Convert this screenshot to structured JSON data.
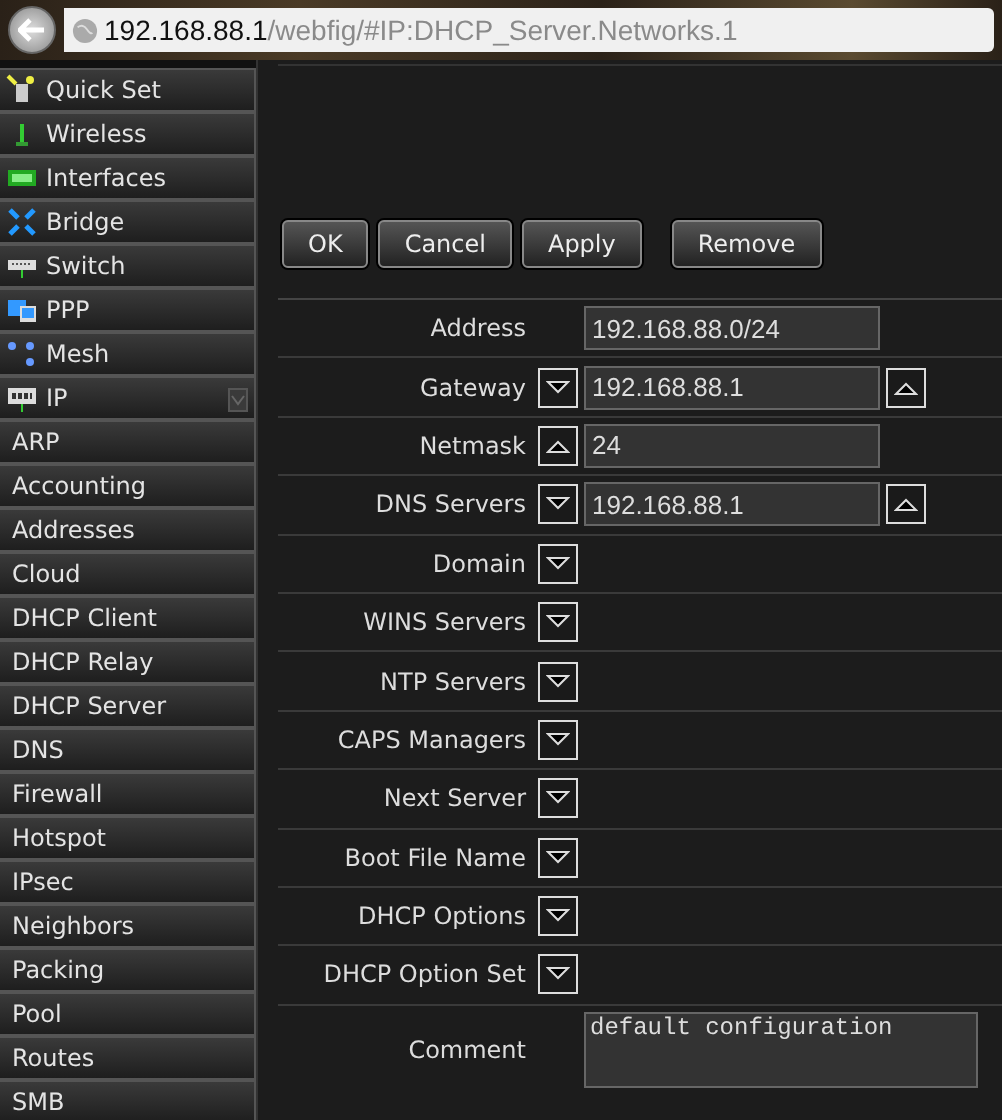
{
  "address_bar": {
    "host": "192.168.88.1",
    "path": "/webfig/#IP:DHCP_Server.Networks.1"
  },
  "menu": [
    {
      "label": "Quick Set"
    },
    {
      "label": "Wireless"
    },
    {
      "label": "Interfaces"
    },
    {
      "label": "Bridge"
    },
    {
      "label": "Switch"
    },
    {
      "label": "PPP"
    },
    {
      "label": "Mesh"
    },
    {
      "label": "IP",
      "expanded": true,
      "children": [
        {
          "label": "ARP"
        },
        {
          "label": "Accounting"
        },
        {
          "label": "Addresses"
        },
        {
          "label": "Cloud"
        },
        {
          "label": "DHCP Client"
        },
        {
          "label": "DHCP Relay"
        },
        {
          "label": "DHCP Server"
        },
        {
          "label": "DNS"
        },
        {
          "label": "Firewall"
        },
        {
          "label": "Hotspot"
        },
        {
          "label": "IPsec"
        },
        {
          "label": "Neighbors"
        },
        {
          "label": "Packing"
        },
        {
          "label": "Pool"
        },
        {
          "label": "Routes"
        },
        {
          "label": "SMB"
        }
      ]
    }
  ],
  "buttons": [
    "OK",
    "Cancel",
    "Apply",
    "Remove"
  ],
  "fields": [
    {
      "label": "Address",
      "kind": "text",
      "value": "192.168.88.0/24"
    },
    {
      "label": "Gateway",
      "kind": "text",
      "value": "192.168.88.1",
      "left_button": {
        "kind": "down"
      },
      "right_button": {
        "kind": "up"
      }
    },
    {
      "label": "Netmask",
      "kind": "text",
      "value": "24",
      "left_button": {
        "kind": "up"
      }
    },
    {
      "label": "DNS Servers",
      "kind": "text",
      "value": "192.168.88.1",
      "left_button": {
        "kind": "down"
      },
      "right_button": {
        "kind": "up"
      }
    },
    {
      "label": "Domain",
      "kind": "expander",
      "left_button": {
        "kind": "down"
      }
    },
    {
      "label": "WINS Servers",
      "kind": "expander",
      "left_button": {
        "kind": "down"
      }
    },
    {
      "label": "NTP Servers",
      "kind": "expander",
      "left_button": {
        "kind": "down"
      }
    },
    {
      "label": "CAPS Managers",
      "kind": "expander",
      "left_button": {
        "kind": "down"
      }
    },
    {
      "label": "Next Server",
      "kind": "expander",
      "left_button": {
        "kind": "down"
      }
    },
    {
      "label": "Boot File Name",
      "kind": "expander",
      "left_button": {
        "kind": "down"
      }
    },
    {
      "label": "DHCP Options",
      "kind": "expander",
      "left_button": {
        "kind": "down"
      }
    },
    {
      "label": "DHCP Option Set",
      "kind": "expander",
      "left_button": {
        "kind": "down"
      }
    },
    {
      "label": "Comment",
      "kind": "textarea",
      "value": "default configuration"
    }
  ]
}
